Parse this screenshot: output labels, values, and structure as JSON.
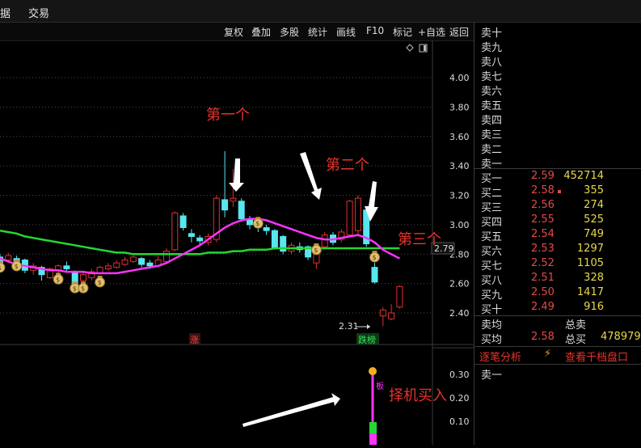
{
  "menu": {
    "items": [
      "据",
      "交易"
    ]
  },
  "toolbar": {
    "buttons": [
      "复权",
      "叠加",
      "多股",
      "统计",
      "画线",
      "F10",
      "标记",
      "+自选",
      "返回"
    ]
  },
  "chart_data": {
    "type": "candlestick",
    "price_axis": {
      "ticks": [
        "4.00",
        "3.80",
        "3.60",
        "3.40",
        "3.20",
        "3.00",
        "2.80",
        "2.60",
        "2.40"
      ],
      "ylim": [
        2.3,
        4.1
      ]
    },
    "current_price_label": "2.79",
    "low_marker": "2.31",
    "annotations": [
      "第一个",
      "第二个",
      "第三个",
      "择机买入"
    ],
    "badges": [
      "涨",
      "跌榜"
    ],
    "candles": [
      {
        "o": 2.78,
        "c": 2.74,
        "h": 2.8,
        "l": 2.72
      },
      {
        "o": 2.76,
        "c": 2.79,
        "h": 2.81,
        "l": 2.74
      },
      {
        "o": 2.77,
        "c": 2.75,
        "h": 2.79,
        "l": 2.73
      },
      {
        "o": 2.76,
        "c": 2.69,
        "h": 2.77,
        "l": 2.67
      },
      {
        "o": 2.69,
        "c": 2.72,
        "h": 2.74,
        "l": 2.66
      },
      {
        "o": 2.71,
        "c": 2.66,
        "h": 2.72,
        "l": 2.62
      },
      {
        "o": 2.64,
        "c": 2.7,
        "h": 2.71,
        "l": 2.63
      },
      {
        "o": 2.69,
        "c": 2.72,
        "h": 2.73,
        "l": 2.67
      },
      {
        "o": 2.72,
        "c": 2.7,
        "h": 2.75,
        "l": 2.68
      },
      {
        "o": 2.68,
        "c": 2.6,
        "h": 2.69,
        "l": 2.58
      },
      {
        "o": 2.62,
        "c": 2.66,
        "h": 2.68,
        "l": 2.6
      },
      {
        "o": 2.64,
        "c": 2.68,
        "h": 2.7,
        "l": 2.62
      },
      {
        "o": 2.67,
        "c": 2.71,
        "h": 2.72,
        "l": 2.66
      },
      {
        "o": 2.7,
        "c": 2.72,
        "h": 2.74,
        "l": 2.69
      },
      {
        "o": 2.71,
        "c": 2.74,
        "h": 2.76,
        "l": 2.7
      },
      {
        "o": 2.73,
        "c": 2.76,
        "h": 2.78,
        "l": 2.72
      },
      {
        "o": 2.75,
        "c": 2.78,
        "h": 2.8,
        "l": 2.74
      },
      {
        "o": 2.77,
        "c": 2.73,
        "h": 2.78,
        "l": 2.71
      },
      {
        "o": 2.74,
        "c": 2.72,
        "h": 2.76,
        "l": 2.7
      },
      {
        "o": 2.72,
        "c": 2.76,
        "h": 2.79,
        "l": 2.71
      },
      {
        "o": 2.75,
        "c": 2.82,
        "h": 2.84,
        "l": 2.74
      },
      {
        "o": 2.83,
        "c": 3.08,
        "h": 3.09,
        "l": 2.82
      },
      {
        "o": 3.06,
        "c": 2.98,
        "h": 3.08,
        "l": 2.96
      },
      {
        "o": 2.94,
        "c": 2.92,
        "h": 2.97,
        "l": 2.88
      },
      {
        "o": 2.91,
        "c": 2.89,
        "h": 2.93,
        "l": 2.86
      },
      {
        "o": 2.88,
        "c": 2.92,
        "h": 2.94,
        "l": 2.86
      },
      {
        "o": 2.9,
        "c": 3.18,
        "h": 3.2,
        "l": 2.88
      },
      {
        "o": 3.17,
        "c": 3.1,
        "h": 3.5,
        "l": 3.05
      },
      {
        "o": 3.16,
        "c": 3.18,
        "h": 3.38,
        "l": 3.12
      },
      {
        "o": 3.16,
        "c": 3.04,
        "h": 3.18,
        "l": 3.02
      },
      {
        "o": 3.04,
        "c": 3.0,
        "h": 3.06,
        "l": 2.97
      },
      {
        "o": 3.02,
        "c": 2.98,
        "h": 3.04,
        "l": 2.95
      },
      {
        "o": 2.98,
        "c": 2.96,
        "h": 3.0,
        "l": 2.93
      },
      {
        "o": 2.96,
        "c": 2.84,
        "h": 2.97,
        "l": 2.83
      },
      {
        "o": 2.92,
        "c": 2.82,
        "h": 2.93,
        "l": 2.8
      },
      {
        "o": 2.82,
        "c": 2.86,
        "h": 2.88,
        "l": 2.8
      },
      {
        "o": 2.85,
        "c": 2.83,
        "h": 2.88,
        "l": 2.81
      },
      {
        "o": 2.85,
        "c": 2.78,
        "h": 2.86,
        "l": 2.76
      },
      {
        "o": 2.74,
        "c": 2.8,
        "h": 2.81,
        "l": 2.7
      },
      {
        "o": 2.85,
        "c": 2.93,
        "h": 2.95,
        "l": 2.84
      },
      {
        "o": 2.93,
        "c": 2.88,
        "h": 2.95,
        "l": 2.86
      },
      {
        "o": 2.9,
        "c": 2.95,
        "h": 2.97,
        "l": 2.88
      },
      {
        "o": 2.93,
        "c": 3.16,
        "h": 3.17,
        "l": 2.92
      },
      {
        "o": 2.96,
        "c": 3.18,
        "h": 3.2,
        "l": 2.92
      },
      {
        "o": 3.1,
        "c": 2.87,
        "h": 3.12,
        "l": 2.85
      },
      {
        "o": 2.71,
        "c": 2.61,
        "h": 2.74,
        "l": 2.6
      },
      {
        "o": 2.38,
        "c": 2.42,
        "h": 2.44,
        "l": 2.31
      },
      {
        "o": 2.36,
        "c": 2.4,
        "h": 2.46,
        "l": 2.35
      },
      {
        "o": 2.44,
        "c": 2.58,
        "h": 2.59,
        "l": 2.43
      }
    ],
    "ma_magenta": [
      2.77,
      2.75,
      2.73,
      2.72,
      2.71,
      2.7,
      2.69,
      2.69,
      2.68,
      2.68,
      2.68,
      2.67,
      2.67,
      2.67,
      2.67,
      2.68,
      2.69,
      2.7,
      2.71,
      2.72,
      2.74,
      2.77,
      2.8,
      2.83,
      2.86,
      2.9,
      2.94,
      2.98,
      3.01,
      3.03,
      3.04,
      3.04,
      3.03,
      3.01,
      2.99,
      2.97,
      2.95,
      2.93,
      2.91,
      2.9,
      2.9,
      2.91,
      2.92,
      2.93,
      2.91,
      2.88,
      2.83,
      2.8,
      2.77
    ],
    "ma_green": [
      2.96,
      2.95,
      2.94,
      2.92,
      2.91,
      2.9,
      2.89,
      2.88,
      2.87,
      2.86,
      2.85,
      2.84,
      2.83,
      2.82,
      2.81,
      2.81,
      2.8,
      2.8,
      2.8,
      2.8,
      2.8,
      2.8,
      2.8,
      2.8,
      2.8,
      2.81,
      2.81,
      2.81,
      2.82,
      2.82,
      2.83,
      2.83,
      2.83,
      2.84,
      2.84,
      2.84,
      2.84,
      2.84,
      2.84,
      2.84,
      2.84,
      2.84,
      2.84,
      2.84,
      2.84,
      2.84,
      2.84,
      2.84,
      2.84
    ],
    "money_bags": [
      {
        "i": 0,
        "price": 2.72
      },
      {
        "i": 2,
        "price": 2.73
      },
      {
        "i": 7,
        "price": 2.64
      },
      {
        "i": 9,
        "price": 2.58
      },
      {
        "i": 10,
        "price": 2.58
      },
      {
        "i": 12,
        "price": 2.62
      },
      {
        "i": 31,
        "price": 3.02
      },
      {
        "i": 38,
        "price": 2.84
      },
      {
        "i": 45,
        "price": 2.79
      }
    ],
    "indicator_axis": {
      "ticks": [
        "0.30",
        "0.20",
        "0.10"
      ],
      "ylim": [
        0.0,
        0.35
      ]
    },
    "indicator_label": "板"
  },
  "order_book": {
    "sell_labels": [
      "卖十",
      "卖九",
      "卖八",
      "卖七",
      "卖六",
      "卖五",
      "卖四",
      "卖三",
      "卖二",
      "卖一"
    ],
    "buy": [
      {
        "label": "买一",
        "price": "2.59",
        "vol": "452714"
      },
      {
        "label": "买二",
        "price": "2.58",
        "vol": "355"
      },
      {
        "label": "买三",
        "price": "2.56",
        "vol": "274"
      },
      {
        "label": "买四",
        "price": "2.55",
        "vol": "525"
      },
      {
        "label": "买五",
        "price": "2.54",
        "vol": "749"
      },
      {
        "label": "买六",
        "price": "2.53",
        "vol": "1297"
      },
      {
        "label": "买七",
        "price": "2.52",
        "vol": "1105"
      },
      {
        "label": "买八",
        "price": "2.51",
        "vol": "328"
      },
      {
        "label": "买九",
        "price": "2.50",
        "vol": "1417"
      },
      {
        "label": "买十",
        "price": "2.49",
        "vol": "916"
      }
    ],
    "sell_avg_label": "卖均",
    "total_sell_label": "总卖",
    "buy_avg_label": "买均",
    "buy_avg_price": "2.58",
    "total_buy_label": "总买",
    "total_buy_value": "478979",
    "tab_analysis": "逐笔分析",
    "tab_view_all": "查看千档盘口",
    "tick_list_first": "卖一"
  },
  "colors": {
    "up": "#e03030",
    "down": "#58e6f0",
    "ma1": "#ff33ff",
    "ma2": "#22d832",
    "label_red": "#e8332c"
  }
}
